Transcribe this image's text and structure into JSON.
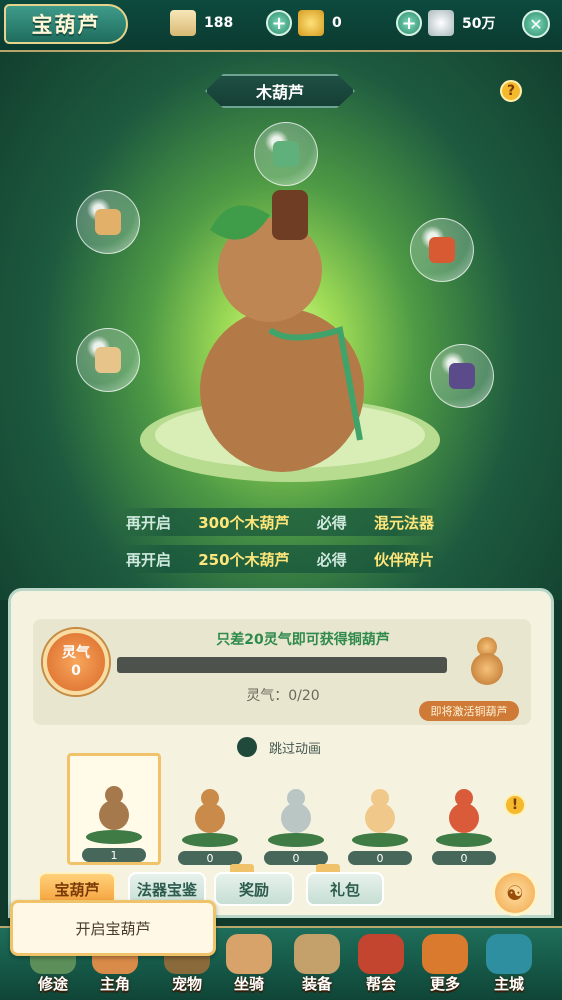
{
  "header": {
    "title": "宝葫芦",
    "resources": [
      {
        "icon": "scroll-icon",
        "value": "188"
      },
      {
        "icon": "gold-ingot-icon",
        "value": "0"
      },
      {
        "icon": "silver-ingot-icon",
        "value": "50万"
      }
    ]
  },
  "gourd": {
    "name": "木葫芦",
    "rewards": [
      {
        "prefix": "再开启",
        "count": "300个木葫芦",
        "mid": "必得",
        "reward": "混元法器"
      },
      {
        "prefix": "再开启",
        "count": "250个木葫芦",
        "mid": "必得",
        "reward": "伙伴碎片"
      }
    ],
    "bubbles": [
      "wand-item-icon",
      "bow-item-icon",
      "gem-item-icon",
      "flask-item-icon",
      "charm-item-icon",
      "dark-orb-item-icon"
    ]
  },
  "progress": {
    "medal_label": "灵气",
    "medal_value": "0",
    "message": "只差20灵气即可获得铜葫芦",
    "readout": "灵气：0/20",
    "fraction": 0,
    "next_tag": "即将激活铜葫芦"
  },
  "skip_label": "跳过动画",
  "slots": [
    {
      "count": "1",
      "selected": true,
      "color": "#a6794c"
    },
    {
      "count": "0",
      "selected": false,
      "color": "#c98a4a"
    },
    {
      "count": "0",
      "selected": false,
      "color": "#b9c6c4"
    },
    {
      "count": "0",
      "selected": false,
      "color": "#f0c98a"
    },
    {
      "count": "0",
      "selected": false,
      "color": "#d95b3a"
    }
  ],
  "tabs": [
    {
      "label": "宝葫芦",
      "active": true
    },
    {
      "label": "法器宝鉴",
      "active": false
    },
    {
      "label": "奖励",
      "active": false
    },
    {
      "label": "礼包",
      "active": false
    }
  ],
  "open_button": "开启宝葫芦",
  "nav": [
    {
      "label": "修途",
      "color": "#5c8f5a"
    },
    {
      "label": "主角",
      "color": "#d98b4a"
    },
    {
      "label": "宠物",
      "color": "#8a6a3a"
    },
    {
      "label": "坐骑",
      "color": "#d7a36a"
    },
    {
      "label": "装备",
      "color": "#c4a06a"
    },
    {
      "label": "帮会",
      "color": "#c4452f"
    },
    {
      "label": "更多",
      "color": "#d97a2e"
    },
    {
      "label": "主城",
      "color": "#2d8f9f"
    }
  ],
  "colors": {
    "accent": "#f5a13b",
    "panel": "#f5f3e0",
    "progress_text": "#2f8a4c"
  }
}
